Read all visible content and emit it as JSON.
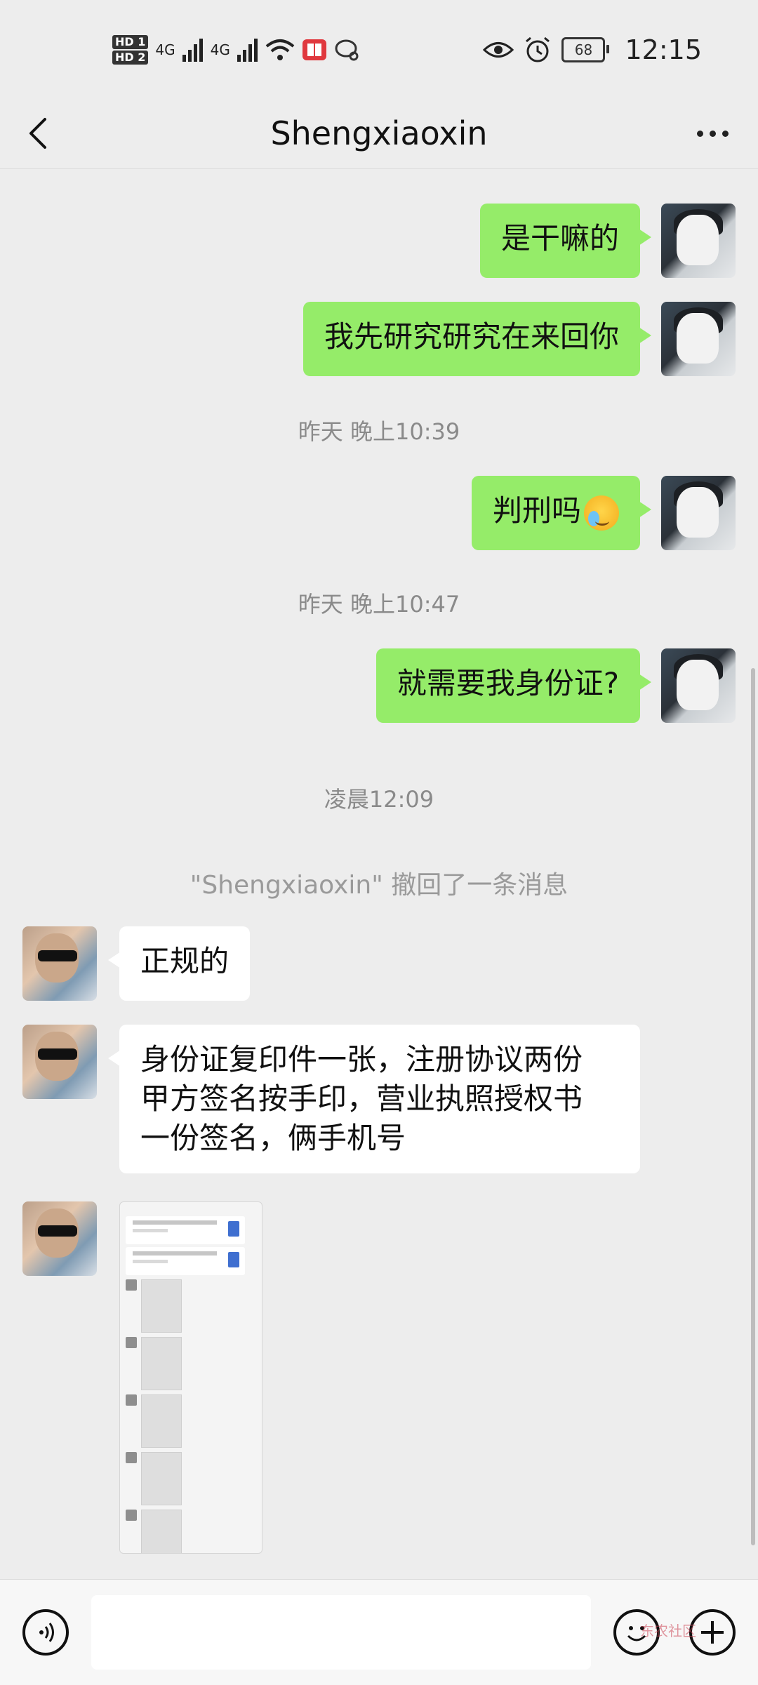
{
  "status_bar": {
    "hd1": "HD 1",
    "hd2": "HD 2",
    "net1": "4G",
    "net2": "4G",
    "battery": "68",
    "time": "12:15"
  },
  "header": {
    "title": "Shengxiaoxin"
  },
  "messages": [
    {
      "text": "是干嘛的"
    },
    {
      "text": "我先研究研究在来回你"
    },
    {
      "time": "昨天 晚上10:39"
    },
    {
      "text": "判刑吗"
    },
    {
      "time": "昨天 晚上10:47"
    },
    {
      "text": "就需要我身份证?"
    },
    {
      "time": "凌晨12:09"
    },
    {
      "system": "\"Shengxiaoxin\" 撤回了一条消息"
    },
    {
      "text": "正规的"
    },
    {
      "line1": "身份证复印件一张，注册协议两份",
      "line2": "甲方签名按手印，营业执照授权书",
      "line3": "一份签名，俩手机号"
    }
  ],
  "input_bar": {
    "watermark": "东农社区"
  }
}
